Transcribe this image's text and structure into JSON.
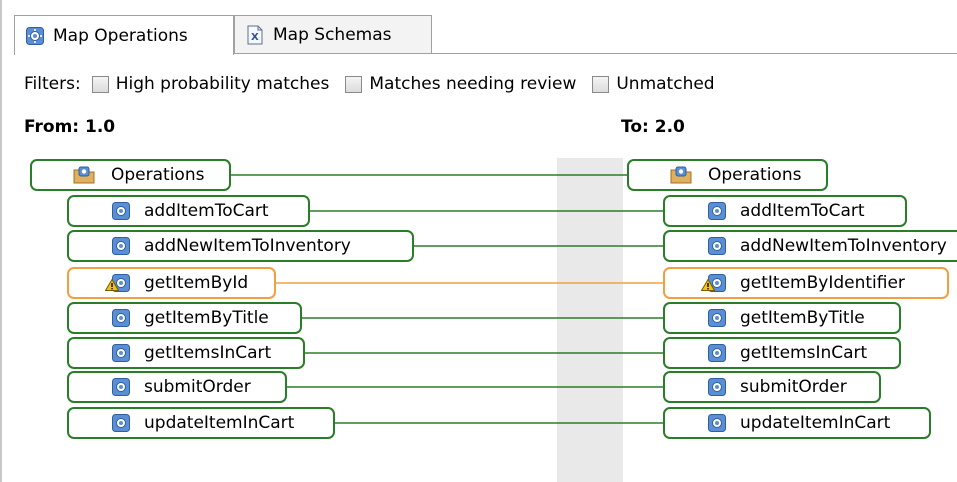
{
  "tabs": [
    {
      "label": "Map Operations",
      "icon": "operation-gear-icon",
      "active": true
    },
    {
      "label": "Map Schemas",
      "icon": "xml-schema-icon",
      "active": false
    }
  ],
  "filters": {
    "label": "Filters:",
    "options": [
      {
        "label": "High probability matches",
        "checked": false
      },
      {
        "label": "Matches needing review",
        "checked": false
      },
      {
        "label": "Unmatched",
        "checked": false
      }
    ]
  },
  "from_header": "From: 1.0",
  "to_header": "To: 2.0",
  "left": {
    "root": "Operations",
    "items": [
      "addItemToCart",
      "addNewItemToInventory",
      "getItemById",
      "getItemByTitle",
      "getItemsInCart",
      "submitOrder",
      "updateItemInCart"
    ]
  },
  "right": {
    "root": "Operations",
    "items": [
      "addItemToCart",
      "addNewItemToInventory",
      "getItemByIdentifier",
      "getItemByTitle",
      "getItemsInCart",
      "submitOrder",
      "updateItemInCart"
    ]
  },
  "needs_review_item": "getItemById",
  "colors": {
    "match_green": "#2a7e2a",
    "review_orange": "#f0a040",
    "gutter": "#e9e9e9"
  }
}
